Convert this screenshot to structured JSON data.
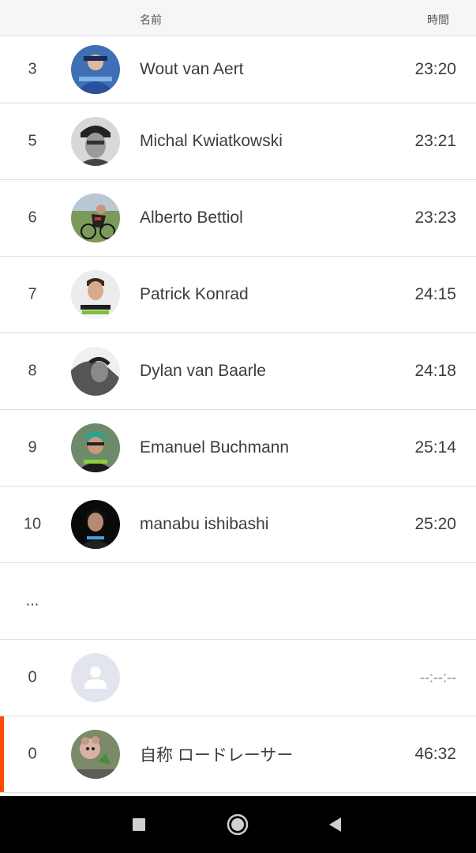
{
  "header": {
    "col_name": "名前",
    "col_time": "時間"
  },
  "rows": [
    {
      "rank": "3",
      "name": "Wout van Aert",
      "time": "23:20"
    },
    {
      "rank": "5",
      "name": "Michal Kwiatkowski",
      "time": "23:21"
    },
    {
      "rank": "6",
      "name": "Alberto Bettiol",
      "time": "23:23"
    },
    {
      "rank": "7",
      "name": "Patrick Konrad",
      "time": "24:15"
    },
    {
      "rank": "8",
      "name": "Dylan van Baarle",
      "time": "24:18"
    },
    {
      "rank": "9",
      "name": "Emanuel Buchmann",
      "time": "25:14"
    },
    {
      "rank": "10",
      "name": "manabu ishibashi",
      "time": "25:20"
    }
  ],
  "gap_row": {
    "label": "..."
  },
  "empty_row": {
    "rank": "0",
    "name": "",
    "time": "--:--:--"
  },
  "me_row": {
    "rank": "0",
    "name": "自称 ロードレーサー",
    "time": "46:32"
  },
  "colors": {
    "accent": "#fc4c02",
    "header_bg": "#f6f6f7",
    "divider": "#e0e0e0"
  },
  "icons": {
    "nav_recents": "square-icon",
    "nav_home": "circle-icon",
    "nav_back": "triangle-back-icon",
    "empty_avatar": "person-icon"
  }
}
